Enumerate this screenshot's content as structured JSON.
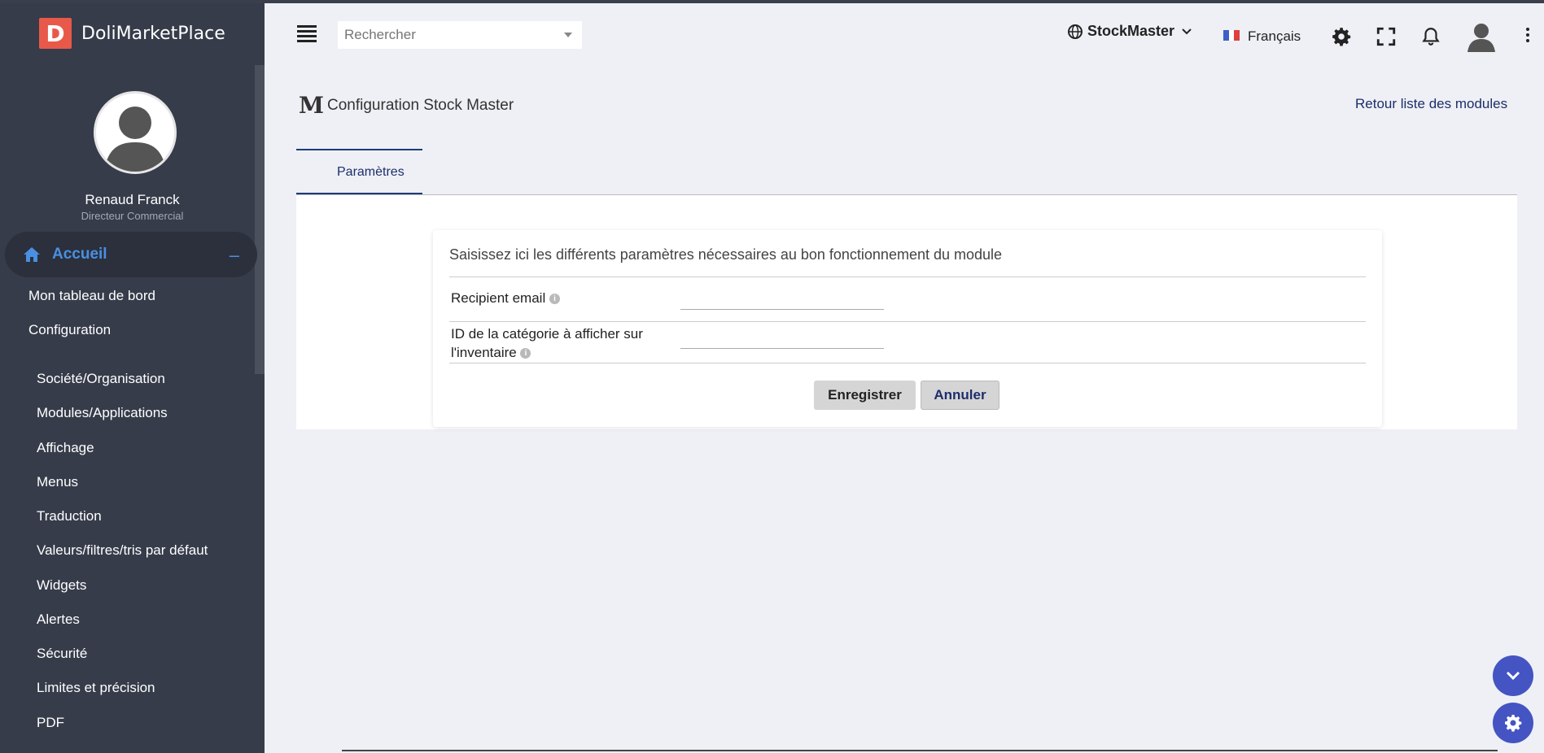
{
  "app": {
    "name": "DoliMarketPlace",
    "logo_letter": "D"
  },
  "user": {
    "name": "Renaud Franck",
    "role": "Directeur Commercial"
  },
  "sidebar": {
    "section": {
      "label": "Accueil",
      "collapse": "–"
    },
    "links": [
      {
        "label": "Mon tableau de bord"
      },
      {
        "label": "Configuration"
      }
    ],
    "sub_items": [
      {
        "label": "Société/Organisation"
      },
      {
        "label": "Modules/Applications"
      },
      {
        "label": "Affichage"
      },
      {
        "label": "Menus"
      },
      {
        "label": "Traduction"
      },
      {
        "label": "Valeurs/filtres/tris par défaut"
      },
      {
        "label": "Widgets"
      },
      {
        "label": "Alertes"
      },
      {
        "label": "Sécurité"
      },
      {
        "label": "Limites et précision"
      },
      {
        "label": "PDF"
      }
    ]
  },
  "header": {
    "search_placeholder": "Rechercher",
    "company": "StockMaster",
    "language": "Français"
  },
  "page": {
    "logo_letter": "M",
    "title": "Configuration Stock Master",
    "back_link": "Retour liste des modules",
    "tab": "Paramètres"
  },
  "form": {
    "intro": "Saisissez ici les différents paramètres nécessaires au bon fonctionnement du module",
    "rows": [
      {
        "label": "Recipient email",
        "value": ""
      },
      {
        "label_line1": "ID de la catégorie à afficher sur",
        "label_line2": "l'inventaire",
        "value": ""
      }
    ],
    "info_glyph": "i",
    "save": "Enregistrer",
    "cancel": "Annuler"
  },
  "colors": {
    "sidebar_bg": "#363c4a",
    "accent": "#4a8fe2",
    "brand_red": "#e8594a",
    "link_navy": "#1d2e6a",
    "fab": "#4454c3"
  }
}
